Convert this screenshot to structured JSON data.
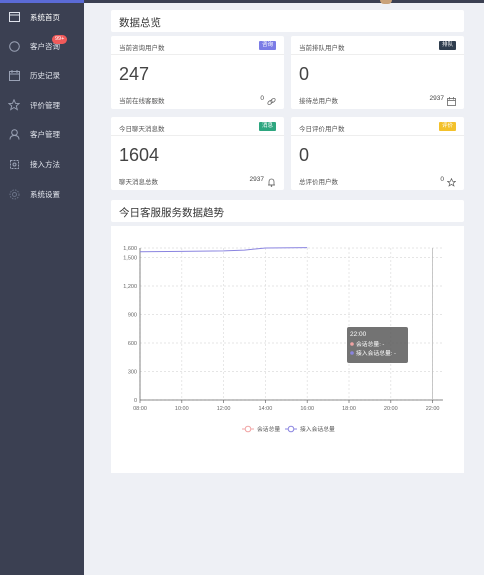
{
  "sidebar": {
    "items": [
      {
        "label": "系统首页",
        "icon": "window-icon"
      },
      {
        "label": "客户咨询",
        "icon": "chat-icon",
        "badge": "99+"
      },
      {
        "label": "历史记录",
        "icon": "calendar-icon"
      },
      {
        "label": "评价管理",
        "icon": "star-icon"
      },
      {
        "label": "客户管理",
        "icon": "user-icon"
      },
      {
        "label": "接入方法",
        "icon": "plugin-icon"
      },
      {
        "label": "系统设置",
        "icon": "gear-icon"
      }
    ]
  },
  "overview": {
    "title": "数据总览",
    "cards": [
      {
        "title": "当前咨询用户数",
        "tag": "咨询",
        "tag_color": "#7b7ce6",
        "value": "247",
        "sub_label": "当前在线客服数",
        "sub_value": "0",
        "sub_icon": "link-icon"
      },
      {
        "title": "当前排队用户数",
        "tag": "排队",
        "tag_color": "#2f3d4e",
        "value": "0",
        "sub_label": "接待总用户数",
        "sub_value": "2937",
        "sub_icon": "calendar-icon"
      },
      {
        "title": "今日聊天消息数",
        "tag": "消息",
        "tag_color": "#2ea67f",
        "value": "1604",
        "sub_label": "聊天消息总数",
        "sub_value": "2937",
        "sub_icon": "bell-icon"
      },
      {
        "title": "今日评价用户数",
        "tag": "评价",
        "tag_color": "#f3c12b",
        "value": "0",
        "sub_label": "总评价用户数",
        "sub_value": "0",
        "sub_icon": "star-icon"
      }
    ]
  },
  "trend": {
    "title": "今日客服服务数据趋势"
  },
  "chart_data": {
    "type": "line",
    "title": "",
    "x": [
      "08:00",
      "10:00",
      "12:00",
      "14:00",
      "16:00",
      "18:00",
      "20:00",
      "22:00"
    ],
    "yticks": [
      "0",
      "300",
      "600",
      "900",
      "1,200",
      "1,500",
      "1,600"
    ],
    "ylim": [
      0,
      1600
    ],
    "grid": true,
    "legend_position": "bottom",
    "series": [
      {
        "name": "会话总量",
        "color": "#f0a3a3",
        "values": []
      },
      {
        "name": "接入会话总量",
        "color": "#8a84e0",
        "values": [
          {
            "x": "08:00",
            "y": 1560
          },
          {
            "x": "10:00",
            "y": 1565
          },
          {
            "x": "12:00",
            "y": 1570
          },
          {
            "x": "13:00",
            "y": 1578
          },
          {
            "x": "14:00",
            "y": 1600
          },
          {
            "x": "16:00",
            "y": 1604
          }
        ]
      }
    ],
    "tooltip": {
      "time": "22:00",
      "rows": [
        {
          "label": "会话总量: -",
          "color": "#f0a3a3"
        },
        {
          "label": "接入会话总量: -",
          "color": "#8a84e0"
        }
      ]
    }
  }
}
